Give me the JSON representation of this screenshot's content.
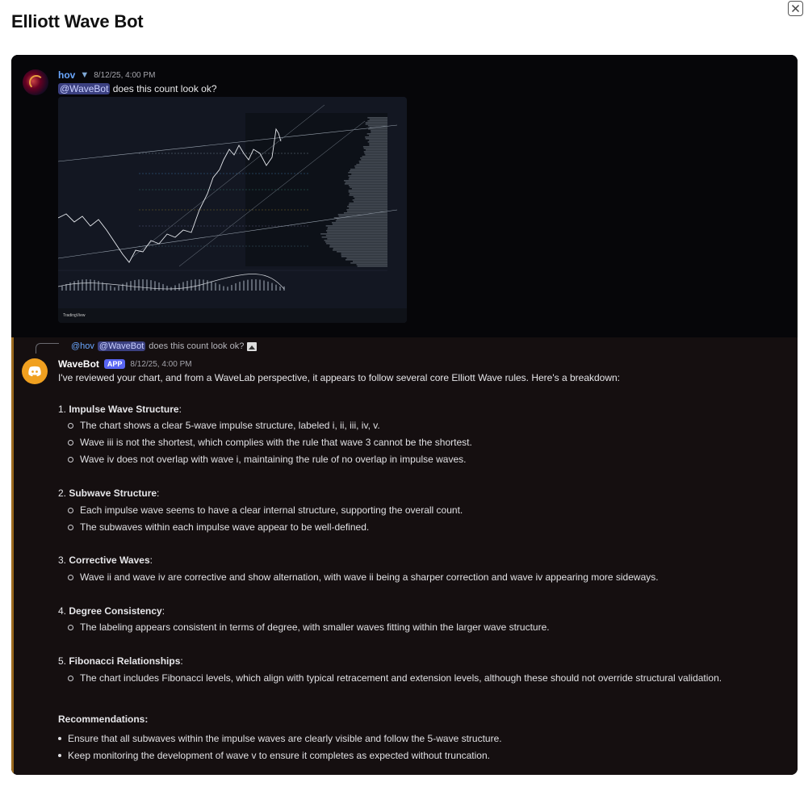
{
  "page": {
    "title": "Elliott Wave Bot"
  },
  "message1": {
    "author": "hov",
    "timestamp": "8/12/25, 4:00 PM",
    "mention": "@WaveBot",
    "text": " does this count look ok?",
    "attachment_brand": "TradingView"
  },
  "reply": {
    "author": "@hov",
    "mention": "@WaveBot",
    "text": "does this count look ok?"
  },
  "message2": {
    "author": "WaveBot",
    "badge": "APP",
    "timestamp": "8/12/25, 4:00 PM",
    "intro": "I've reviewed your chart, and from a WaveLab perspective, it appears to follow several core Elliott Wave rules. Here's a breakdown:",
    "sections": [
      {
        "num": "1. ",
        "title": "Impulse Wave Structure",
        "items": [
          "The chart shows a clear 5-wave impulse structure, labeled i, ii, iii, iv, v.",
          "Wave iii is not the shortest, which complies with the rule that wave 3 cannot be the shortest.",
          "Wave iv does not overlap with wave i, maintaining the rule of no overlap in impulse waves."
        ]
      },
      {
        "num": "2. ",
        "title": "Subwave Structure",
        "items": [
          "Each impulse wave seems to have a clear internal structure, supporting the overall count.",
          "The subwaves within each impulse wave appear to be well-defined."
        ]
      },
      {
        "num": "3. ",
        "title": "Corrective Waves",
        "items": [
          "Wave ii and wave iv are corrective and show alternation, with wave ii being a sharper correction and wave iv appearing more sideways."
        ]
      },
      {
        "num": "4. ",
        "title": "Degree Consistency",
        "items": [
          "The labeling appears consistent in terms of degree, with smaller waves fitting within the larger wave structure."
        ]
      },
      {
        "num": "5. ",
        "title": "Fibonacci Relationships",
        "items": [
          "The chart includes Fibonacci levels, which align with typical retracement and extension levels, although these should not override structural validation."
        ]
      }
    ],
    "recommendations_title": "Recommendations:",
    "recommendations": [
      "Ensure that all subwaves within the impulse waves are clearly visible and follow the 5-wave structure.",
      "Keep monitoring the development of wave v to ensure it completes as expected without truncation."
    ]
  }
}
